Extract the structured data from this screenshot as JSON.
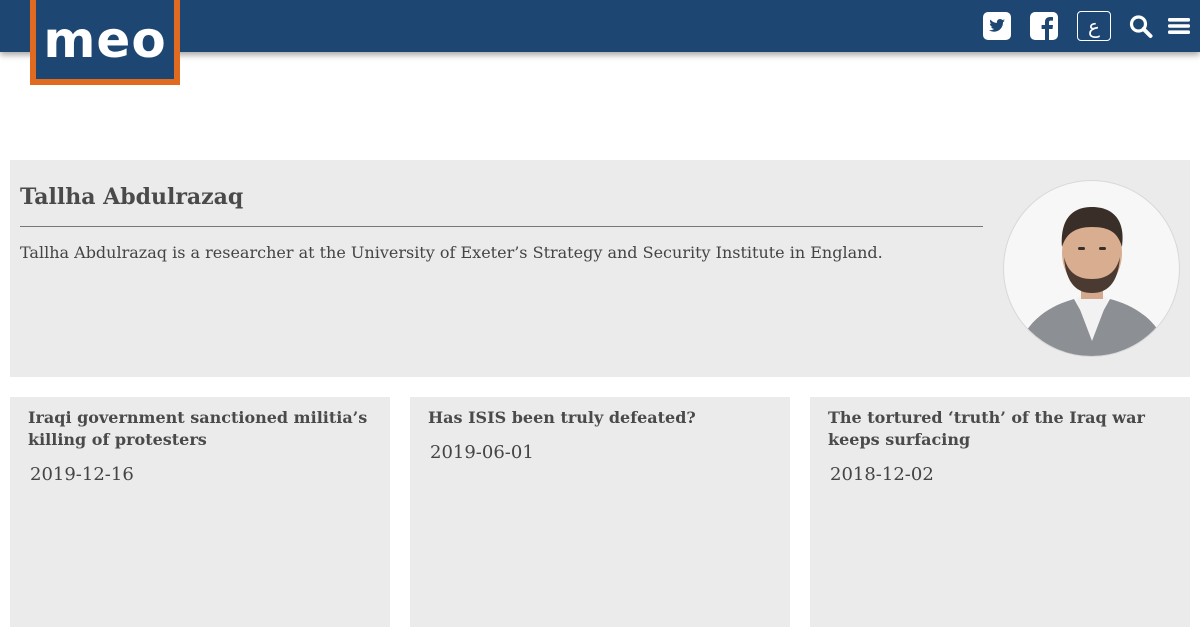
{
  "header": {
    "logo_text": "meo",
    "arabic_label": "ع",
    "brand_color": "#1d4672",
    "accent_color": "#e06a1f",
    "icons": [
      "twitter-icon",
      "facebook-icon",
      "arabic-site-link",
      "search-icon",
      "menu-icon"
    ]
  },
  "author": {
    "name": "Tallha Abdulrazaq",
    "bio": "Tallha Abdulrazaq is a researcher at the University of Exeter’s Strategy and Security Institute in England."
  },
  "articles": [
    {
      "title": "Iraqi government sanctioned militia’s killing of protesters",
      "date": "2019-12-16"
    },
    {
      "title": "Has ISIS been truly defeated?",
      "date": "2019-06-01"
    },
    {
      "title": "The tortured ‘truth’ of the Iraq war keeps surfacing",
      "date": "2018-12-02"
    }
  ]
}
